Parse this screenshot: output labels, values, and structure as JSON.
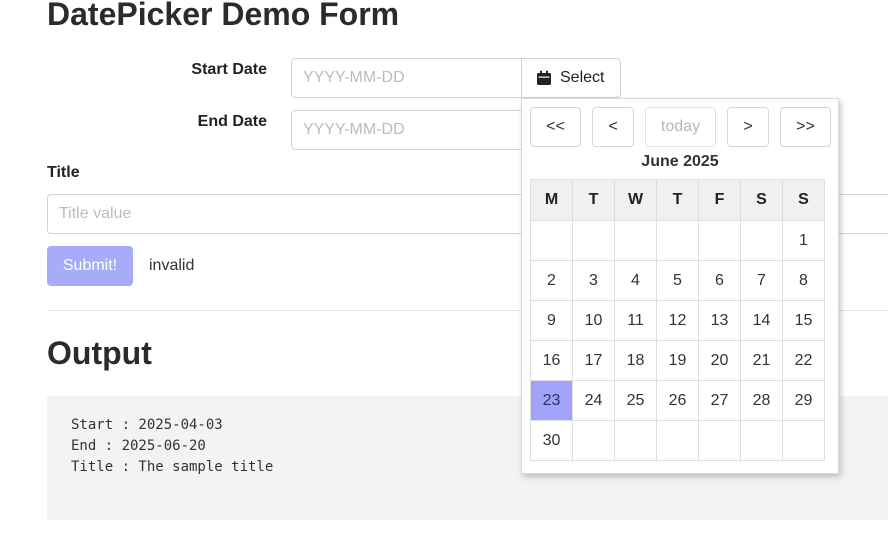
{
  "form": {
    "title": "DatePicker Demo Form",
    "start_date": {
      "label": "Start Date",
      "placeholder": "YYYY-MM-DD",
      "value": ""
    },
    "end_date": {
      "label": "End Date",
      "placeholder": "YYYY-MM-DD",
      "value": ""
    },
    "select_button": {
      "label": "Select",
      "icon": "calendar-icon"
    },
    "title_field": {
      "label": "Title",
      "placeholder": "Title value",
      "value": ""
    },
    "submit_label": "Submit!",
    "status": "invalid"
  },
  "calendar": {
    "nav": {
      "prev_year": "<<",
      "prev_month": "<",
      "today": "today",
      "next_month": ">",
      "next_year": ">>"
    },
    "month_label": "June 2025",
    "weekdays": [
      "M",
      "T",
      "W",
      "T",
      "F",
      "S",
      "S"
    ],
    "weeks": [
      [
        "",
        "",
        "",
        "",
        "",
        "",
        "1"
      ],
      [
        "2",
        "3",
        "4",
        "5",
        "6",
        "7",
        "8"
      ],
      [
        "9",
        "10",
        "11",
        "12",
        "13",
        "14",
        "15"
      ],
      [
        "16",
        "17",
        "18",
        "19",
        "20",
        "21",
        "22"
      ],
      [
        "23",
        "24",
        "25",
        "26",
        "27",
        "28",
        "29"
      ],
      [
        "30",
        "",
        "",
        "",
        "",
        "",
        ""
      ]
    ],
    "selected_day": "23",
    "selected_color": "#a1a2f8"
  },
  "output": {
    "title": "Output",
    "lines": [
      "Start : 2025-04-03",
      "End : 2025-06-20",
      "Title : The sample title"
    ]
  },
  "colors": {
    "submit_bg": "#a6abfa",
    "output_bg": "#f2f3f4"
  }
}
